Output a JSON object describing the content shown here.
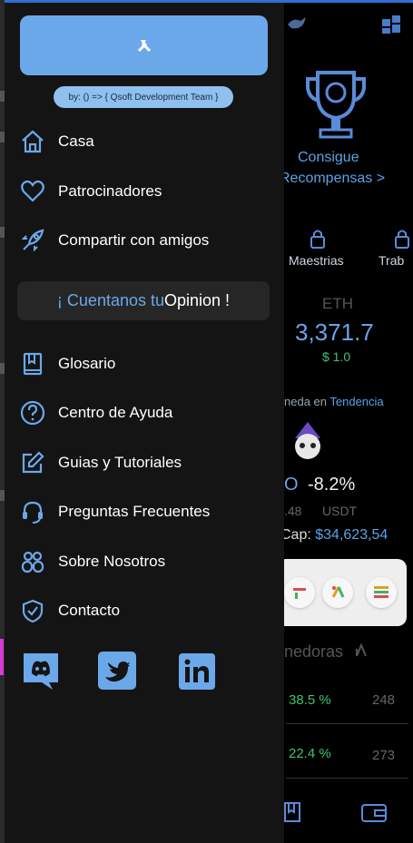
{
  "drawer": {
    "top_button_icon": "tools-icon",
    "credit": "by: () => { Qsoft Development Team }",
    "items_primary": [
      {
        "label": "Casa",
        "icon": "home-icon"
      },
      {
        "label": "Patrocinadores",
        "icon": "heart-icon"
      },
      {
        "label": "Compartir con amigos",
        "icon": "rocket-icon"
      }
    ],
    "opinion": {
      "prefix": "¡ Cuentanos tu ",
      "highlight": "Opinion",
      "suffix": " !"
    },
    "items_secondary": [
      {
        "label": "Glosario",
        "icon": "book-icon"
      },
      {
        "label": "Centro de Ayuda",
        "icon": "help-circle-icon"
      },
      {
        "label": "Guias y Tutoriales",
        "icon": "edit-icon"
      },
      {
        "label": "Preguntas Frecuentes",
        "icon": "headset-icon"
      },
      {
        "label": "Sobre Nosotros",
        "icon": "users-icon"
      },
      {
        "label": "Contacto",
        "icon": "shield-check-icon"
      }
    ],
    "social": [
      "discord-icon",
      "twitter-icon",
      "linkedin-icon"
    ]
  },
  "background": {
    "rewards": "Consigue",
    "rewards2": "Recompensas >",
    "tab_maestrias": "Maestrias",
    "tab_trab": "Trab",
    "coin_symbol": "ETH",
    "coin_price": "3,371.7",
    "coin_change": "$ 1.0",
    "trending_prefix": "neda en ",
    "trending_word": "Tendencia",
    "trend_symbol_part": "O",
    "trend_change": "-8.2%",
    "trend_price_part": ".48",
    "trend_unit": "USDT",
    "cap_prefix": "Cap: ",
    "cap_value": "$34,623,54",
    "winners_title": "nedoras",
    "row1_change": "38.5 %",
    "row1_value": "248",
    "row2_change": "22.4 %",
    "row2_value": "273"
  },
  "colors": {
    "accent": "#6ba8ea",
    "drawer_bg": "#141414",
    "positive": "#3ec46d"
  }
}
